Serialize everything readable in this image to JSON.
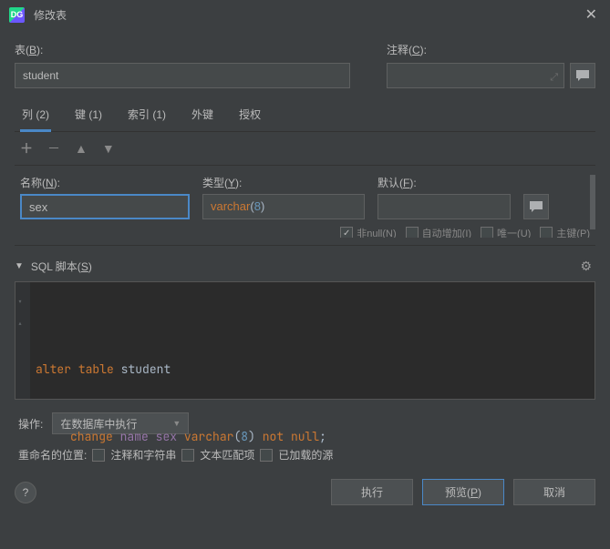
{
  "window": {
    "title": "修改表"
  },
  "labels": {
    "table": "表(",
    "table_key": "B",
    "table_suffix": "):",
    "comment": "注释(",
    "comment_key": "C",
    "comment_suffix": "):"
  },
  "table_name": "student",
  "tabs": {
    "columns": "列 (2)",
    "keys": "键 (1)",
    "indexes": "索引 (1)",
    "foreign_keys": "外键",
    "grants": "授权"
  },
  "column_editor": {
    "name_label": "名称(",
    "name_key": "N",
    "name_suffix": "):",
    "type_label": "类型(",
    "type_key": "Y",
    "type_suffix": "):",
    "default_label": "默认(",
    "default_key": "F",
    "default_suffix": "):",
    "name_value": "sex",
    "type_fn": "varchar",
    "type_num": "8",
    "default_value": "",
    "checks": {
      "notnull": "非null(N)",
      "autoinc": "自动增加(I)",
      "unique": "唯一(U)",
      "primary": "主键(P)"
    }
  },
  "sql_section": {
    "title": "SQL 脚本(",
    "title_key": "S",
    "title_suffix": ")"
  },
  "sql": {
    "line1": {
      "kw1": "alter",
      "kw2": "table",
      "ident": "student"
    },
    "line2": {
      "kw1": "change",
      "c1": "name",
      "c2": "sex",
      "fn": "varchar",
      "num": "8",
      "kw2": "not",
      "kw3": "null",
      "semi": ";"
    }
  },
  "bottom": {
    "action_label": "操作:",
    "action_value": "在数据库中执行",
    "rename_label": "重命名的位置:",
    "opt1": "注释和字符串",
    "opt2": "文本匹配项",
    "opt3": "已加载的源"
  },
  "footer": {
    "help": "?",
    "execute": "执行",
    "preview": "预览(",
    "preview_key": "P",
    "preview_suffix": ")",
    "cancel": "取消"
  }
}
